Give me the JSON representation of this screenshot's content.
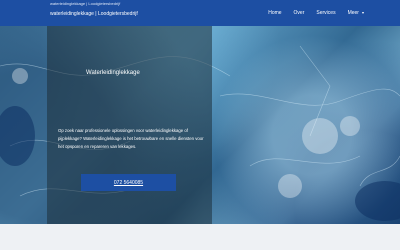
{
  "header": {
    "brand_small": "waterleidinglekkage | Loodgietersbedrijf",
    "brand": "waterleidinglekkage | Loodgietersbedrijf",
    "nav": [
      {
        "label": "Home"
      },
      {
        "label": "Over"
      },
      {
        "label": "Services"
      },
      {
        "label": "Meer",
        "icon": "chevron-down-icon"
      }
    ]
  },
  "hero": {
    "title": "Waterleidinglekkage",
    "description": "Op zoek naar professionele oplossingen voor waterleidinglekkage of pijplekkage? Waterleidinglekkage is het betrouwbare en snelle diensten voor het opsporen en repareren van lekkages.",
    "cta_label": "072 5640085"
  },
  "colors": {
    "header_bg": "#1d4fa3",
    "button_bg": "#1d4fa3",
    "panel_overlay": "rgba(30,48,58,0.55)",
    "page_bg": "#eef1f4"
  }
}
